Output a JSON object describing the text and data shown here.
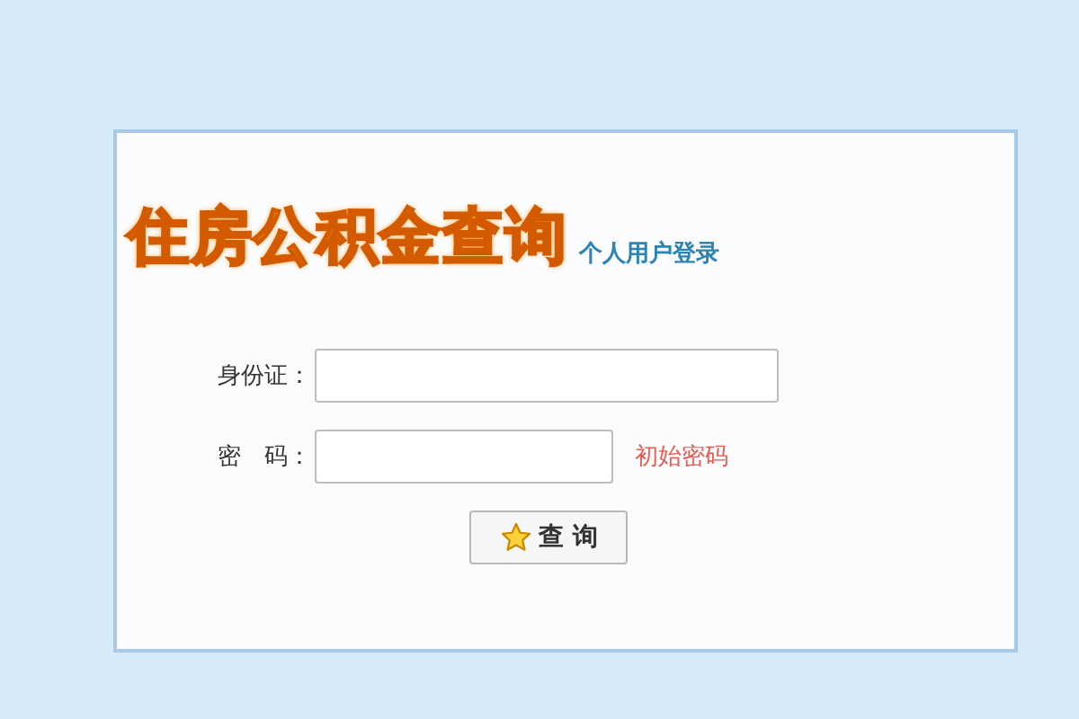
{
  "title": "住房公积金查询",
  "subtitle": "个人用户登录",
  "fields": [
    {
      "label": "身份证：",
      "kind": "id"
    },
    {
      "label": "密　码：",
      "kind": "password",
      "link": "初始密码"
    }
  ],
  "button": "查 询"
}
